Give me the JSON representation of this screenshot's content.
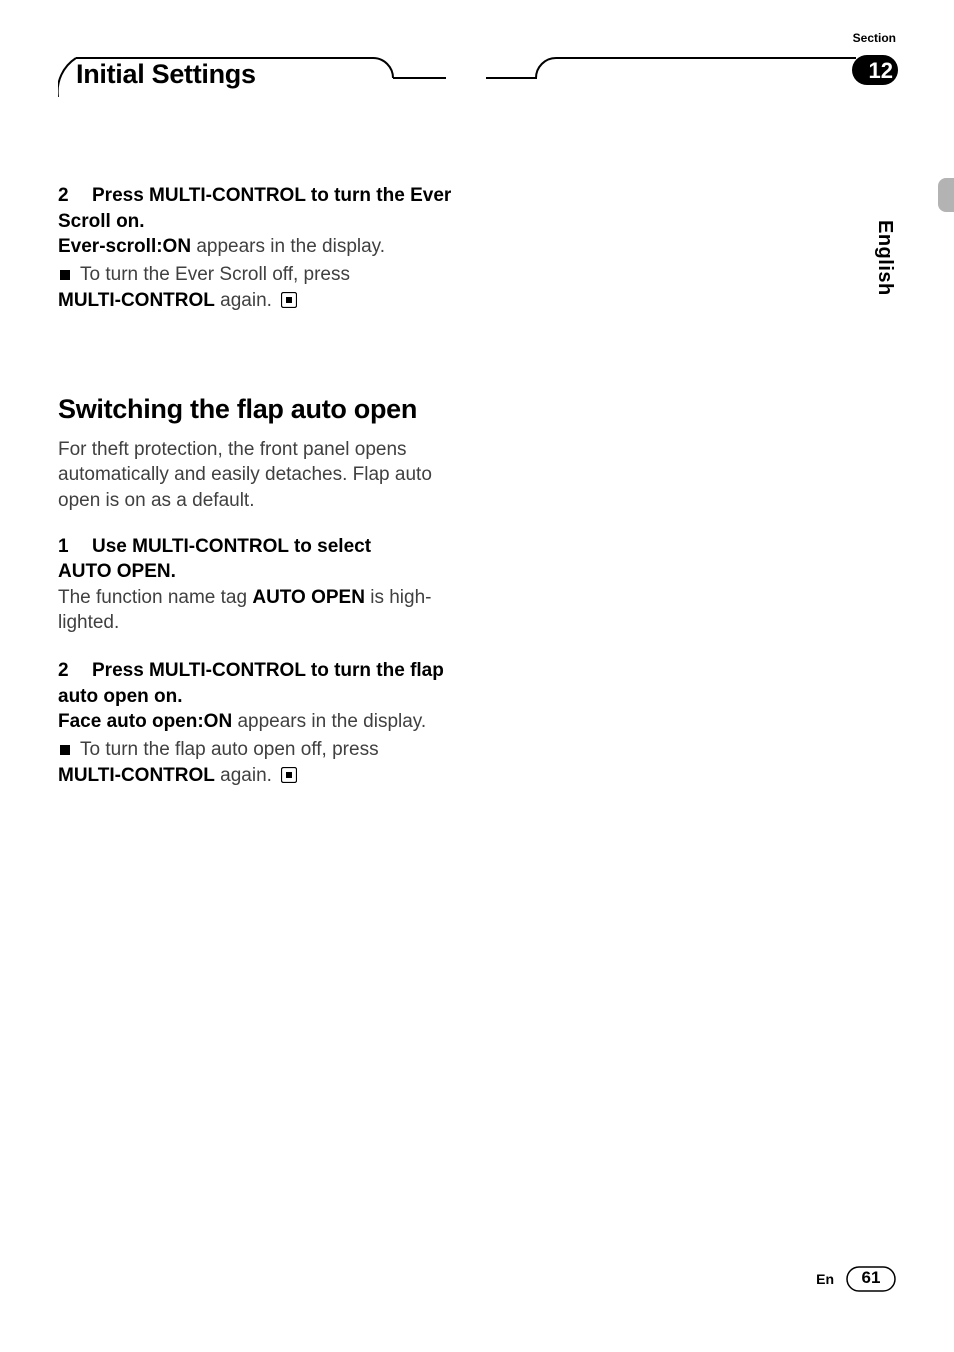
{
  "header": {
    "title": "Initial Settings",
    "section_label": "Section",
    "section_number": "12"
  },
  "side": {
    "language": "English"
  },
  "block1": {
    "step_num": "2",
    "step_text_a": "Press MULTI-CONTROL to turn the Ever",
    "step_text_b": "Scroll on.",
    "disp_bold": "Ever-scroll",
    "disp_colon_bold": ":ON",
    "disp_tail": " appears in the display.",
    "bullet_text": "To turn the Ever Scroll off, press",
    "bullet_bold": "MULTI-CONTROL",
    "bullet_tail": " again."
  },
  "h2": "Switching the flap auto open",
  "intro": "For theft protection, the front panel opens automatically and easily detaches. Flap auto open is on as a default.",
  "block2": {
    "step_num": "1",
    "step_text_a": "Use MULTI-CONTROL to select",
    "step_text_b": "AUTO OPEN.",
    "body_a": "The function name tag ",
    "body_bold": "AUTO OPEN",
    "body_b": " is high-",
    "body_c": "lighted."
  },
  "block3": {
    "step_num": "2",
    "step_text_a": "Press MULTI-CONTROL to turn the flap",
    "step_text_b": "auto open on.",
    "disp_bold": "Face auto open",
    "disp_colon_bold": ":ON",
    "disp_tail": " appears in the display.",
    "bullet_text": "To turn the flap auto open off, press",
    "bullet_bold": "MULTI-CONTROL",
    "bullet_tail": " again."
  },
  "footer": {
    "lang_code": "En",
    "page": "61"
  }
}
